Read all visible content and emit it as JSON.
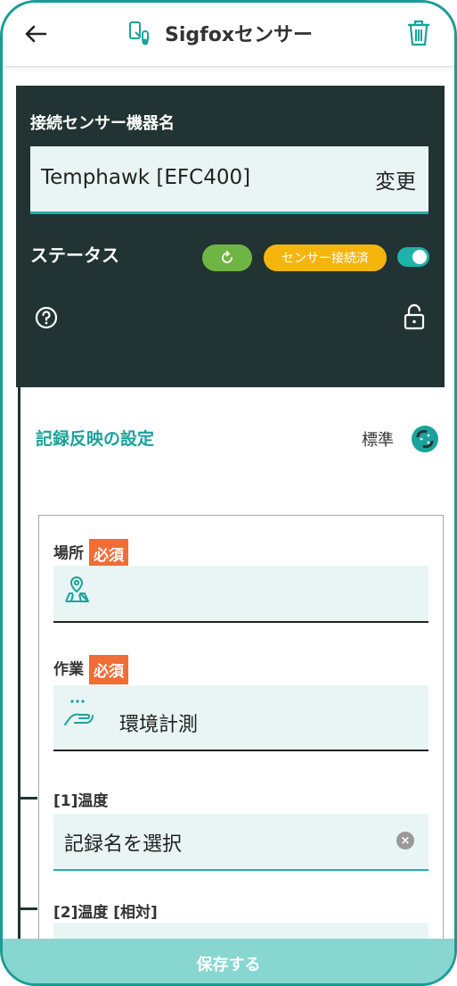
{
  "header": {
    "title": "Sigfoxセンサー",
    "back_icon": "arrow-left-icon",
    "title_icon": "sensor-device-icon",
    "delete_icon": "trash-icon"
  },
  "device_panel": {
    "label": "接続センサー機器名",
    "device_name": "Temphawk [EFC400]",
    "change_label": "変更",
    "status_label": "ステータス",
    "status_badge": "センサー接続済",
    "toggle_on": true
  },
  "settings": {
    "title": "記録反映の設定",
    "mode_label": "標準"
  },
  "form": {
    "location": {
      "label": "場所",
      "required": "必須",
      "value": ""
    },
    "work": {
      "label": "作業",
      "required": "必須",
      "value": "環境計測"
    },
    "field1": {
      "label": "[1]温度",
      "value": "記録名を選択"
    },
    "field2": {
      "label": "[2]温度 [相対]",
      "value": ""
    }
  },
  "footer": {
    "save_label": "保存する"
  },
  "colors": {
    "accent": "#1fb2aa",
    "panel_bg": "#213433",
    "required_badge": "#f26c36",
    "status_badge": "#f5b50d",
    "refresh_pill": "#6fb543",
    "save_bar": "#88d6d0"
  }
}
